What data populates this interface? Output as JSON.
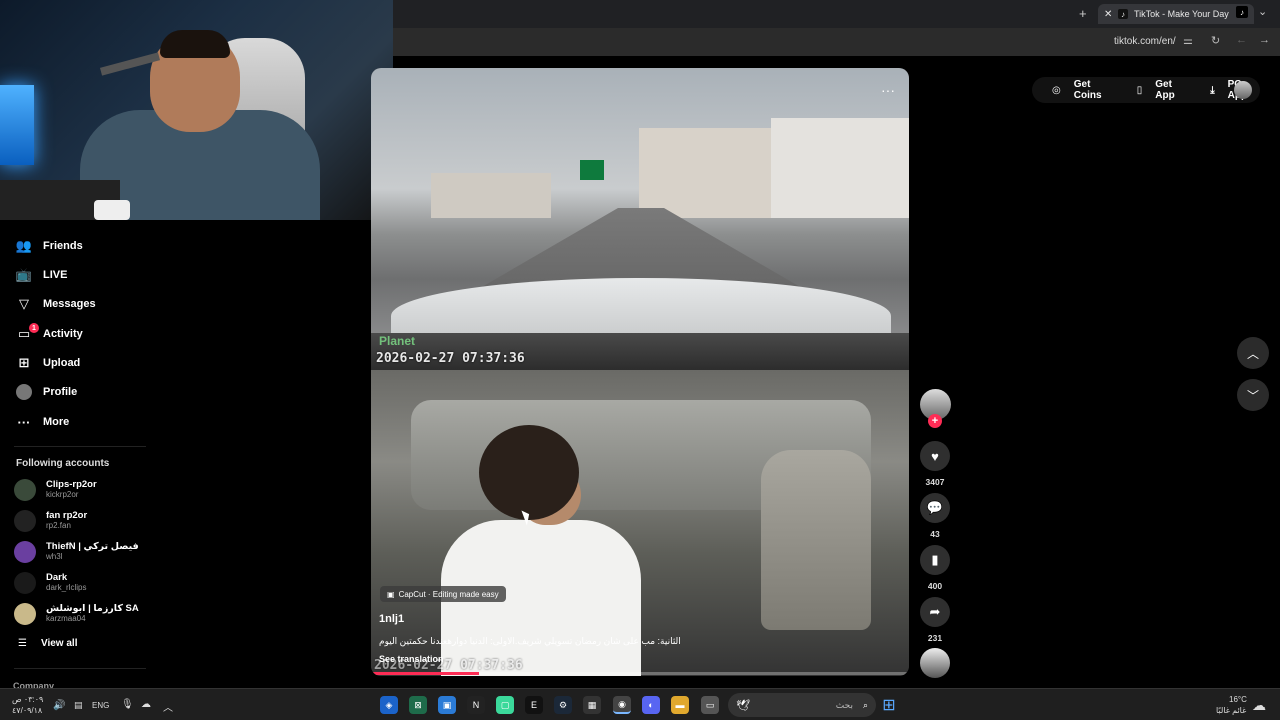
{
  "browser": {
    "tab_title": "TikTok - Make Your Day",
    "url": "tiktok.com/en/",
    "new_tab_symbol": "+",
    "close_symbol": "✕"
  },
  "header": {
    "get_coins": "Get Coins",
    "get_app": "Get App",
    "pc_app": "PC App"
  },
  "sidebar": {
    "items": [
      {
        "label": "Friends",
        "icon": "friends-icon"
      },
      {
        "label": "LIVE",
        "icon": "live-icon"
      },
      {
        "label": "Messages",
        "icon": "messages-icon"
      },
      {
        "label": "Activity",
        "icon": "activity-icon",
        "badge": "1"
      },
      {
        "label": "Upload",
        "icon": "upload-icon"
      },
      {
        "label": "Profile",
        "icon": "profile-icon"
      },
      {
        "label": "More",
        "icon": "more-icon"
      }
    ],
    "following_title": "Following accounts",
    "accounts": [
      {
        "name": "Clips-rp2or",
        "handle": "kickrp2or"
      },
      {
        "name": "fan rp2or",
        "handle": "rp2.fan"
      },
      {
        "name": "ThiefN | فيصل تركي",
        "handle": "wh3l"
      },
      {
        "name": "Dark",
        "handle": "dark_rlclips"
      },
      {
        "name": "كارزما | ابوشلش SA",
        "handle": "karzmaa04"
      }
    ],
    "view_all": "View all",
    "company": "Company"
  },
  "video": {
    "timestamp_top": "2026-02-27  07:37:36",
    "brand": "Planet",
    "timestamp_bottom": "2026-02-27  07:37:36",
    "capcut": "CapCut · Editing made easy",
    "username": "1nlj1",
    "description": "الثانية: مب على شان رمضان تسويلي شريف.الاولى: الدنيا دوارهعندنا حكمتين اليوم",
    "see_translation": "See translation",
    "progress_fraction": 0.2
  },
  "actions": {
    "likes": "3407",
    "comments": "43",
    "saves": "400",
    "shares": "231"
  },
  "taskbar": {
    "time": "٠٣:٠٩ ص",
    "date": "٤٧/٠٩/١٨",
    "lang": "ENG",
    "search_placeholder": "بحث",
    "weather_temp": "16°C",
    "weather_desc": "غائم غالبًا"
  }
}
